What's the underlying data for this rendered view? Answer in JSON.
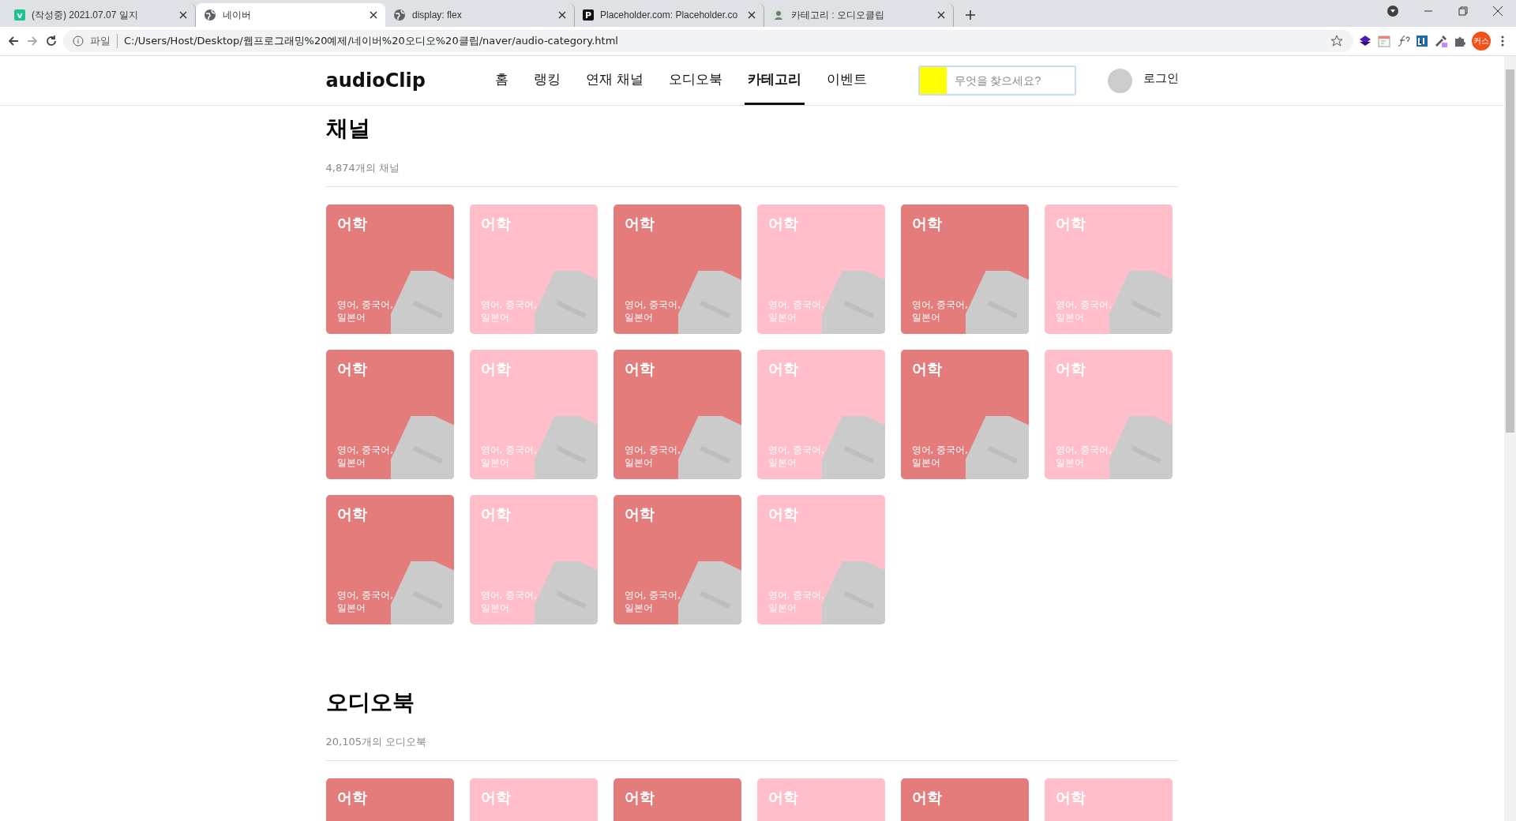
{
  "browser": {
    "tabs": [
      {
        "title": "(작성중) 2021.07.07 일지",
        "kind": "letter",
        "icon_text": "v",
        "selected": false
      },
      {
        "title": "네이버",
        "kind": "globe",
        "selected": true
      },
      {
        "title": "display: flex",
        "kind": "globe",
        "selected": false
      },
      {
        "title": "Placeholder.com: Placeholder.co",
        "kind": "letter",
        "icon_text": "P",
        "selected": false
      },
      {
        "title": "카테고리 : 오디오클립",
        "kind": "avatar",
        "selected": false
      }
    ],
    "address": {
      "scheme": "파일",
      "url": "C:/Users/Host/Desktop/웹프로그래밍%20예제/네이버%20오디오%20클립/naver/audio-category.html"
    },
    "profile": "커스"
  },
  "header": {
    "logo": "audioClip",
    "nav": [
      {
        "label": "홈",
        "selected": false
      },
      {
        "label": "랭킹",
        "selected": false
      },
      {
        "label": "연재 채널",
        "selected": false
      },
      {
        "label": "오디오북",
        "selected": false
      },
      {
        "label": "카테고리",
        "selected": true
      },
      {
        "label": "이벤트",
        "selected": false
      }
    ],
    "search": {
      "placeholder": "무엇을 찾으세요?"
    },
    "login": "로그인"
  },
  "sections": [
    {
      "title": "채널",
      "count": "4,874개의 채널",
      "cards": [
        {
          "title": "어학",
          "subtitle": "영어, 중국어, 일본어",
          "color": "#e57c7c"
        },
        {
          "title": "어학",
          "subtitle": "영어, 중국어, 일본어",
          "color": "#ffbec9"
        },
        {
          "title": "어학",
          "subtitle": "영어, 중국어, 일본어",
          "color": "#e57c7c"
        },
        {
          "title": "어학",
          "subtitle": "영어, 중국어, 일본어",
          "color": "#ffbec9"
        },
        {
          "title": "어학",
          "subtitle": "영어, 중국어, 일본어",
          "color": "#e57c7c"
        },
        {
          "title": "어학",
          "subtitle": "영어, 중국어, 일본어",
          "color": "#ffbec9"
        },
        {
          "title": "어학",
          "subtitle": "영어, 중국어, 일본어",
          "color": "#e57c7c"
        },
        {
          "title": "어학",
          "subtitle": "영어, 중국어, 일본어",
          "color": "#ffbec9"
        },
        {
          "title": "어학",
          "subtitle": "영어, 중국어, 일본어",
          "color": "#e57c7c"
        },
        {
          "title": "어학",
          "subtitle": "영어, 중국어, 일본어",
          "color": "#ffbec9"
        },
        {
          "title": "어학",
          "subtitle": "영어, 중국어, 일본어",
          "color": "#e57c7c"
        },
        {
          "title": "어학",
          "subtitle": "영어, 중국어, 일본어",
          "color": "#ffbec9"
        },
        {
          "title": "어학",
          "subtitle": "영어, 중국어, 일본어",
          "color": "#e57c7c"
        },
        {
          "title": "어학",
          "subtitle": "영어, 중국어, 일본어",
          "color": "#ffbec9"
        },
        {
          "title": "어학",
          "subtitle": "영어, 중국어, 일본어",
          "color": "#e57c7c"
        },
        {
          "title": "어학",
          "subtitle": "영어, 중국어, 일본어",
          "color": "#ffbec9"
        }
      ]
    },
    {
      "title": "오디오북",
      "count": "20,105개의 오디오북",
      "cards": [
        {
          "title": "어학",
          "color": "#e57c7c"
        },
        {
          "title": "어학",
          "color": "#ffbec9"
        },
        {
          "title": "어학",
          "color": "#e57c7c"
        },
        {
          "title": "어학",
          "color": "#ffbec9"
        },
        {
          "title": "어학",
          "color": "#e57c7c"
        },
        {
          "title": "어학",
          "color": "#ffbec9"
        }
      ]
    }
  ]
}
